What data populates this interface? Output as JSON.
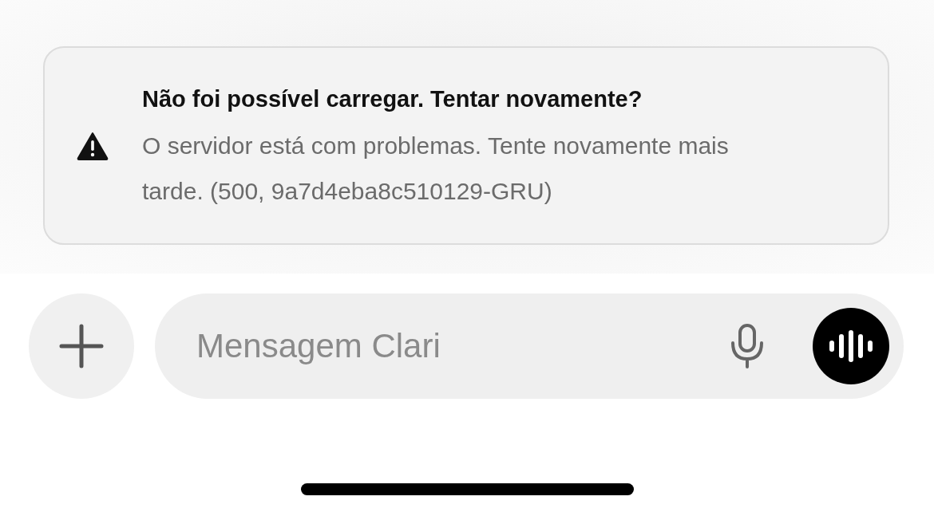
{
  "alert": {
    "title": "Não foi possível carregar. Tentar novamente?",
    "message": "O servidor está com problemas. Tente novamente mais tarde. (500, 9a7d4eba8c510129-GRU)"
  },
  "composer": {
    "placeholder": "Mensagem Clari"
  }
}
